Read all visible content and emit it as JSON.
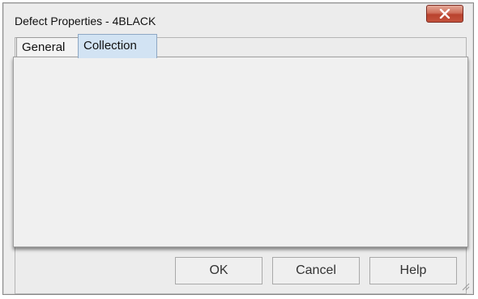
{
  "window": {
    "title": "Defect Properties - 4BLACK",
    "close_icon": "close-icon"
  },
  "tabs": [
    {
      "label": "General",
      "selected": false
    },
    {
      "label": "Collection",
      "selected": true
    }
  ],
  "buttons": {
    "ok": "OK",
    "cancel": "Cancel",
    "help": "Help"
  },
  "colors": {
    "close_button": "#c4533d",
    "selected_tab": "#d2e3f3"
  }
}
